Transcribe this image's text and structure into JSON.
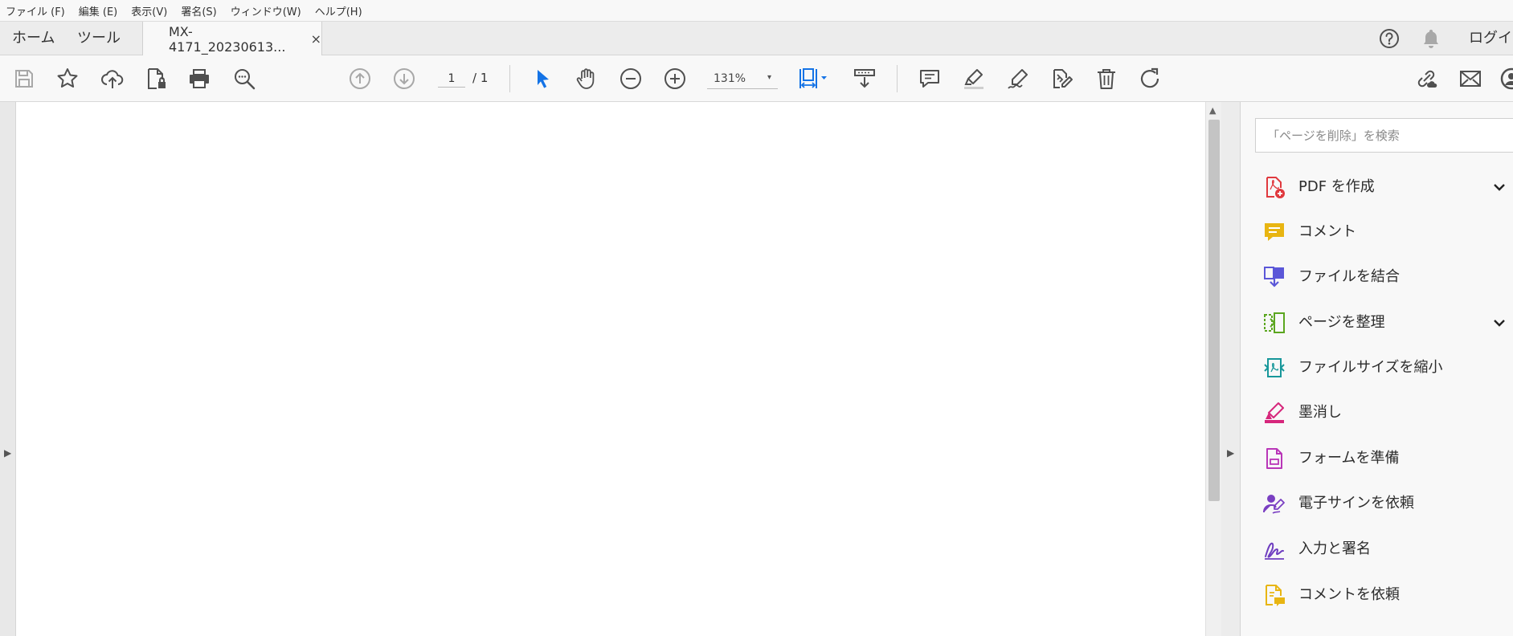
{
  "menubar": {
    "items": [
      "ファイル (F)",
      "編集 (E)",
      "表示(V)",
      "署名(S)",
      "ウィンドウ(W)",
      "ヘルプ(H)"
    ]
  },
  "tabs": {
    "home_label": "ホーム",
    "tools_label": "ツール",
    "document_label": "MX-4171_20230613...",
    "close_glyph": "×"
  },
  "header": {
    "login_label": "ログイン"
  },
  "toolbar": {
    "current_page": "1",
    "page_total": "/ 1",
    "zoom_value": "131%",
    "zoom_caret": "▾"
  },
  "scroll": {
    "up_glyph": "▲"
  },
  "panels": {
    "expand_glyph": "▶"
  },
  "tools_pane": {
    "search_placeholder": "「ページを削除」を検索",
    "items": [
      {
        "label": "PDF を作成",
        "icon": "create-pdf-icon",
        "color": "#e0393e"
      },
      {
        "label": "コメント",
        "icon": "comment-icon",
        "color": "#e8b512"
      },
      {
        "label": "ファイルを結合",
        "icon": "combine-files-icon",
        "color": "#5b57d8"
      },
      {
        "label": "ページを整理",
        "icon": "organize-pages-icon",
        "color": "#5ba61f"
      },
      {
        "label": "ファイルサイズを縮小",
        "icon": "compress-pdf-icon",
        "color": "#17979a"
      },
      {
        "label": "墨消し",
        "icon": "redact-icon",
        "color": "#d6267b"
      },
      {
        "label": "フォームを準備",
        "icon": "prepare-form-icon",
        "color": "#b936b8"
      },
      {
        "label": "電子サインを依頼",
        "icon": "request-esign-icon",
        "color": "#7a3fc2"
      },
      {
        "label": "入力と署名",
        "icon": "fill-sign-icon",
        "color": "#6f3ec0"
      },
      {
        "label": "コメントを依頼",
        "icon": "send-for-comments-icon",
        "color": "#e8b512"
      }
    ]
  },
  "colors": {
    "accent_blue": "#1473e6",
    "icon_gray": "#505050",
    "disabled_gray": "#a8a8a8"
  }
}
